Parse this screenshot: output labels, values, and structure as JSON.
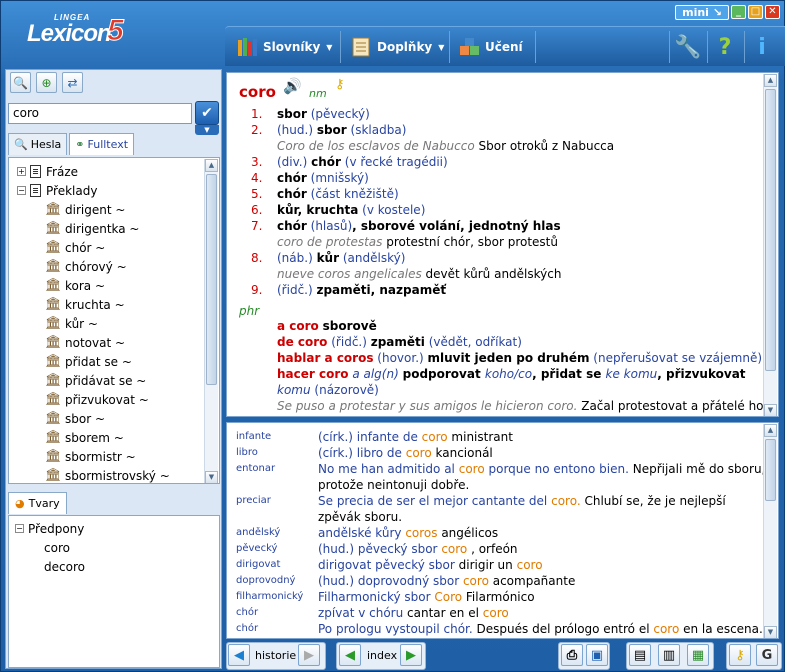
{
  "title": {
    "brand_small": "LINGEA",
    "brand": "Lexicon",
    "brand_num": "5",
    "mini_label": "mini"
  },
  "menu": {
    "slovniky": "Slovníky",
    "doplnky": "Doplňky",
    "uceni": "Učení"
  },
  "search": {
    "value": "coro"
  },
  "tabs": {
    "hesla": "Hesla",
    "fulltext": "Fulltext"
  },
  "tree": {
    "fraze": "Fráze",
    "preklady": "Překlady",
    "items": [
      "dirigent ~",
      "dirigentka ~",
      "chór ~",
      "chórový ~",
      "kora ~",
      "kruchta ~",
      "kůr ~",
      "notovat ~",
      "přidat se ~",
      "přidávat se ~",
      "přizvukovat ~",
      "sbor ~",
      "sborem ~",
      "sbormistr ~",
      "sbormistrovský ~"
    ]
  },
  "tvary": {
    "tab_label": "Tvary",
    "root": "Předpony",
    "items": [
      "coro",
      "decoro"
    ]
  },
  "entry": {
    "headword": "coro",
    "gram": "nm",
    "senses": [
      {
        "n": "1.",
        "parts": [
          [
            "b",
            "sbor"
          ],
          [
            "g",
            " (pěvecký)"
          ]
        ]
      },
      {
        "n": "2.",
        "parts": [
          [
            "g",
            "(hud.) "
          ],
          [
            "b",
            "sbor"
          ],
          [
            "g",
            " (skladba)"
          ]
        ]
      },
      {
        "n": "",
        "parts": [
          [
            "i",
            "Coro de los esclavos de Nabucco"
          ],
          [
            "t",
            "  Sbor otroků z Nabucca"
          ]
        ]
      },
      {
        "n": "3.",
        "parts": [
          [
            "g",
            "(div.) "
          ],
          [
            "b",
            "chór"
          ],
          [
            "g",
            " (v řecké tragédii)"
          ]
        ]
      },
      {
        "n": "4.",
        "parts": [
          [
            "b",
            "chór"
          ],
          [
            "g",
            " (mnišský)"
          ]
        ]
      },
      {
        "n": "5.",
        "parts": [
          [
            "b",
            "chór"
          ],
          [
            "g",
            " (část kněžiště)"
          ]
        ]
      },
      {
        "n": "6.",
        "parts": [
          [
            "b",
            "kůr, kruchta"
          ],
          [
            "g",
            " (v kostele)"
          ]
        ]
      },
      {
        "n": "7.",
        "parts": [
          [
            "b",
            "chór"
          ],
          [
            "g",
            " (hlasů)"
          ],
          [
            "b",
            ", sborové volání, jednotný hlas"
          ]
        ]
      },
      {
        "n": "",
        "parts": [
          [
            "i",
            "coro de protestas"
          ],
          [
            "t",
            "  protestní chór, sbor protestů"
          ]
        ]
      },
      {
        "n": "8.",
        "parts": [
          [
            "g",
            "(náb.) "
          ],
          [
            "b",
            "kůr"
          ],
          [
            "g",
            " (andělský)"
          ]
        ]
      },
      {
        "n": "",
        "parts": [
          [
            "i",
            "nueve coros angelicales"
          ],
          [
            "t",
            "  devět kůrů andělských"
          ]
        ]
      },
      {
        "n": "9.",
        "parts": [
          [
            "g",
            "(řidč.) "
          ],
          [
            "b",
            "zpaměti, nazpaměť"
          ]
        ]
      }
    ],
    "phr_label": "phr",
    "phrases": [
      [
        [
          "r",
          "a coro"
        ],
        [
          "t",
          "  "
        ],
        [
          "b",
          "sborově"
        ]
      ],
      [
        [
          "r",
          "de coro"
        ],
        [
          "g",
          "  (řidč.)  "
        ],
        [
          "b",
          "zpaměti"
        ],
        [
          "g",
          " (vědět, odříkat)"
        ]
      ],
      [
        [
          "r",
          "hablar a coros"
        ],
        [
          "g",
          "  (hovor.)  "
        ],
        [
          "b",
          "mluvit jeden po druhém"
        ],
        [
          "g",
          "  (nepřerušovat se vzájemně)"
        ]
      ],
      [
        [
          "r",
          "hacer coro"
        ],
        [
          "bi",
          " a alg(n)"
        ],
        [
          "t",
          "  "
        ],
        [
          "b",
          "podporovat "
        ],
        [
          "bi",
          "koho/co"
        ],
        [
          "b",
          ", přidat se "
        ],
        [
          "bi",
          "ke komu"
        ],
        [
          "b",
          ", přizvukovat"
        ]
      ],
      [
        [
          "bi",
          "komu"
        ],
        [
          "g",
          " (názorově)"
        ]
      ],
      [
        [
          "i",
          "Se puso a protestar y sus amigos le hicieron coro."
        ],
        [
          "t",
          "  Začal protestovat a přátelé ho"
        ]
      ]
    ]
  },
  "examples": [
    {
      "key": "infante",
      "parts": [
        [
          "g",
          "(círk.) infante de "
        ],
        [
          "o",
          "coro"
        ],
        [
          "t",
          "  ministrant"
        ]
      ]
    },
    {
      "key": "libro",
      "parts": [
        [
          "g",
          "(círk.) libro de "
        ],
        [
          "o",
          "coro"
        ],
        [
          "t",
          "  kancionál"
        ]
      ]
    },
    {
      "key": "entonar",
      "parts": [
        [
          "g",
          "No me han admitido al "
        ],
        [
          "o",
          "coro"
        ],
        [
          "g",
          " porque no entono bien."
        ],
        [
          "t",
          "  Nepřijali mě do sboru,"
        ]
      ]
    },
    {
      "key": "",
      "parts": [
        [
          "t",
          "protože neintonuji dobře."
        ]
      ]
    },
    {
      "key": "preciar",
      "parts": [
        [
          "g",
          "Se precia de ser el mejor cantante del "
        ],
        [
          "o",
          "coro."
        ],
        [
          "t",
          "  Chlubí se, že je nejlepší"
        ]
      ]
    },
    {
      "key": "",
      "parts": [
        [
          "t",
          "zpěvák sboru."
        ]
      ]
    },
    {
      "key": "andělský",
      "parts": [
        [
          "g",
          "andělské kůry  "
        ],
        [
          "o",
          "coros"
        ],
        [
          "t",
          "  angélicos"
        ]
      ]
    },
    {
      "key": "pěvecký",
      "parts": [
        [
          "g",
          "(hud.) pěvecký sbor  "
        ],
        [
          "o",
          "coro"
        ],
        [
          "t",
          " , orfeón"
        ]
      ]
    },
    {
      "key": "dirigovat",
      "parts": [
        [
          "g",
          "dirigovat pěvecký sbor"
        ],
        [
          "t",
          "  dirigir un "
        ],
        [
          "o",
          "coro"
        ]
      ]
    },
    {
      "key": "doprovodný",
      "parts": [
        [
          "g",
          "(hud.) doprovodný sbor  "
        ],
        [
          "o",
          "coro"
        ],
        [
          "t",
          "  acompañante"
        ]
      ]
    },
    {
      "key": "filharmonický",
      "parts": [
        [
          "g",
          "Filharmonický sbor  "
        ],
        [
          "o",
          "Coro"
        ],
        [
          "t",
          "  Filarmónico"
        ]
      ]
    },
    {
      "key": "chór",
      "parts": [
        [
          "g",
          "zpívat v chóru"
        ],
        [
          "t",
          "  cantar en el "
        ],
        [
          "o",
          "coro"
        ]
      ]
    },
    {
      "key": "chór",
      "parts": [
        [
          "g",
          "Po prologu vystoupil chór."
        ],
        [
          "t",
          "  Después del prólogo entró el "
        ],
        [
          "o",
          "coro"
        ],
        [
          "t",
          " en la escena."
        ]
      ]
    }
  ],
  "bottom": {
    "historie": "historie",
    "index": "index"
  },
  "colors": {
    "accent": "#2468b0",
    "headword": "#cc0000",
    "orange": "#e07b00",
    "blue": "#2844a0"
  }
}
